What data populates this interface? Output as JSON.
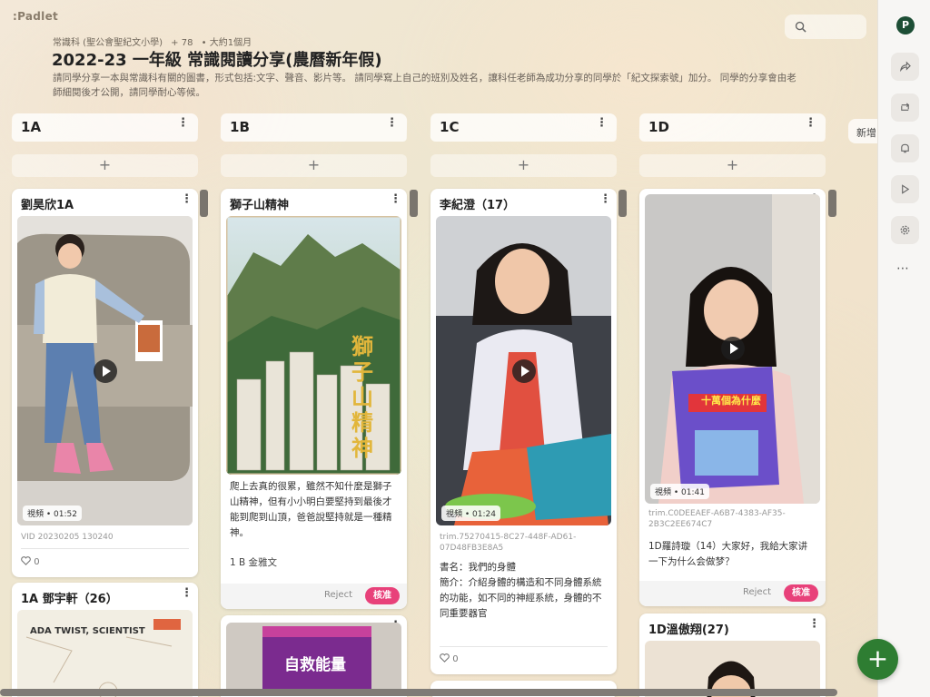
{
  "app": {
    "logo": ":Padlet"
  },
  "header": {
    "author": "常識科 (聖公會聖紀文小學)",
    "count": "+ 78",
    "time": "• 大約1個月",
    "title": "2022-23 一年級 常識閱讀分享(農曆新年假)",
    "description": "請同學分享一本與常識科有關的圖書，形式包括:文字、聲音、影片等。 請同學寫上自己的班別及姓名，讓科任老師為成功分享的同學於「紀文探索號」加分。 同學的分享會由老師細閱後才公開，請同學耐心等候。"
  },
  "rail": {
    "avatar": "P",
    "more": "⋯",
    "new_tab": "新增"
  },
  "icons": {
    "search": "search-icon",
    "share": "share-icon",
    "remake": "remake-icon",
    "bell": "bell-icon",
    "slideshow": "play-icon",
    "settings": "gear-icon",
    "add": "plus-icon"
  },
  "columns": [
    {
      "name": "1A",
      "add": "+",
      "cards": [
        {
          "title": "劉昊欣1A",
          "duration": "視頻 • 01:52",
          "caption": "VID 20230205 130240",
          "likes": "0"
        },
        {
          "title": "1A 鄧宇軒（26）",
          "book": "ADA TWIST, SCIENTIST"
        }
      ]
    },
    {
      "name": "1B",
      "add": "+",
      "cards": [
        {
          "title": "獅子山精神",
          "cover_title": "獅子山精神",
          "text": "爬上去真的很累，雖然不知什麼是獅子山精神，但有小小明白要堅持到最後才能到爬到山頂，爸爸說堅持就是一種精神。",
          "author": "1 B 金雅文",
          "reject": "Reject",
          "approve": "核准"
        },
        {
          "title": "",
          "book": "自救能量"
        }
      ]
    },
    {
      "name": "1C",
      "add": "+",
      "cards": [
        {
          "title": "李紀澄（17）",
          "duration": "視頻 • 01:24",
          "caption": "trim.75270415-8C27-448F-AD61-07D48FB3E8A5",
          "text1": "書名：我們的身體",
          "text2": "簡介：介紹身體的構造和不同身體系統的功能，如不同的神經系統，身體的不同重要器官",
          "likes": "0"
        }
      ]
    },
    {
      "name": "1D",
      "add": "+",
      "cards": [
        {
          "title": "",
          "duration": "視頻 • 01:41",
          "caption": "trim.C0DEEAEF-A6B7-4383-AF35-2B3C2EE674C7",
          "text": "1D羅詩璇（14）大家好，我給大家讲一下为什么会做梦？",
          "book": "十萬個為什麼",
          "reject": "Reject",
          "approve": "核准"
        },
        {
          "title": "1D溫傲翔(27)"
        }
      ]
    }
  ],
  "colors": {
    "accent": "#e8417a",
    "fab": "#2e7d32",
    "avatar": "#1d4e35"
  }
}
